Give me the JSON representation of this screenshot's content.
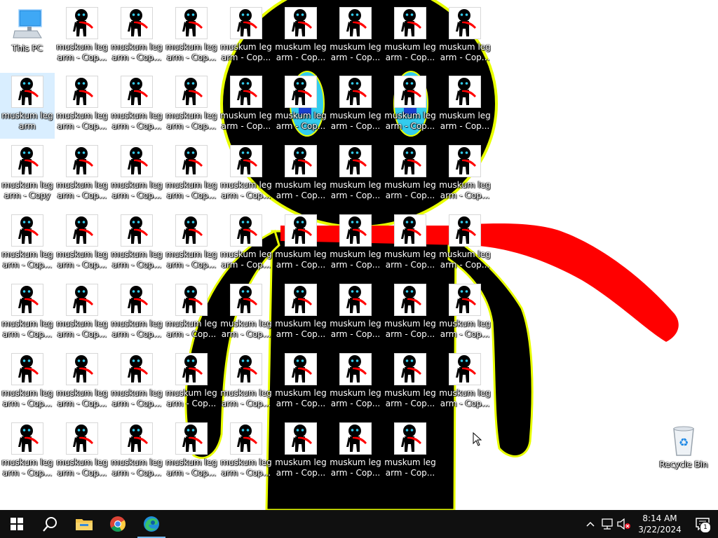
{
  "desktop": {
    "this_pc": {
      "label": "This PC",
      "icon": "computer-monitor-icon"
    },
    "recycle_bin": {
      "label": "Recycle Bin",
      "icon": "recycle-bin-icon"
    },
    "selected_file": {
      "label": "muskum leg arm",
      "icon": "stick-figure-thumbnail-icon"
    },
    "copy_file_label": "muskum leg arm - Cop...",
    "copy_file_label_full": "muskum leg arm - Copy",
    "copy_file_icon": "stick-figure-thumbnail-icon"
  },
  "taskbar": {
    "start": {
      "icon": "windows-start-icon"
    },
    "search": {
      "icon": "search-icon"
    },
    "pinned": [
      {
        "name": "File Explorer",
        "icon": "folder-icon"
      },
      {
        "name": "Google Chrome",
        "icon": "chrome-icon"
      },
      {
        "name": "Microsoft Edge",
        "icon": "edge-icon"
      }
    ],
    "tray": {
      "icons": [
        "chevron-up-icon",
        "network-icon",
        "speaker-muted-icon"
      ],
      "time": "8:14 AM",
      "date": "3/22/2024",
      "notification_count": "1"
    }
  },
  "colors": {
    "taskbar": "#101010",
    "figure": "#000000",
    "outline": "#e8ff00",
    "scarf": "#ff0000",
    "eyes": "#33ccee",
    "selection": "#cce8ff"
  }
}
